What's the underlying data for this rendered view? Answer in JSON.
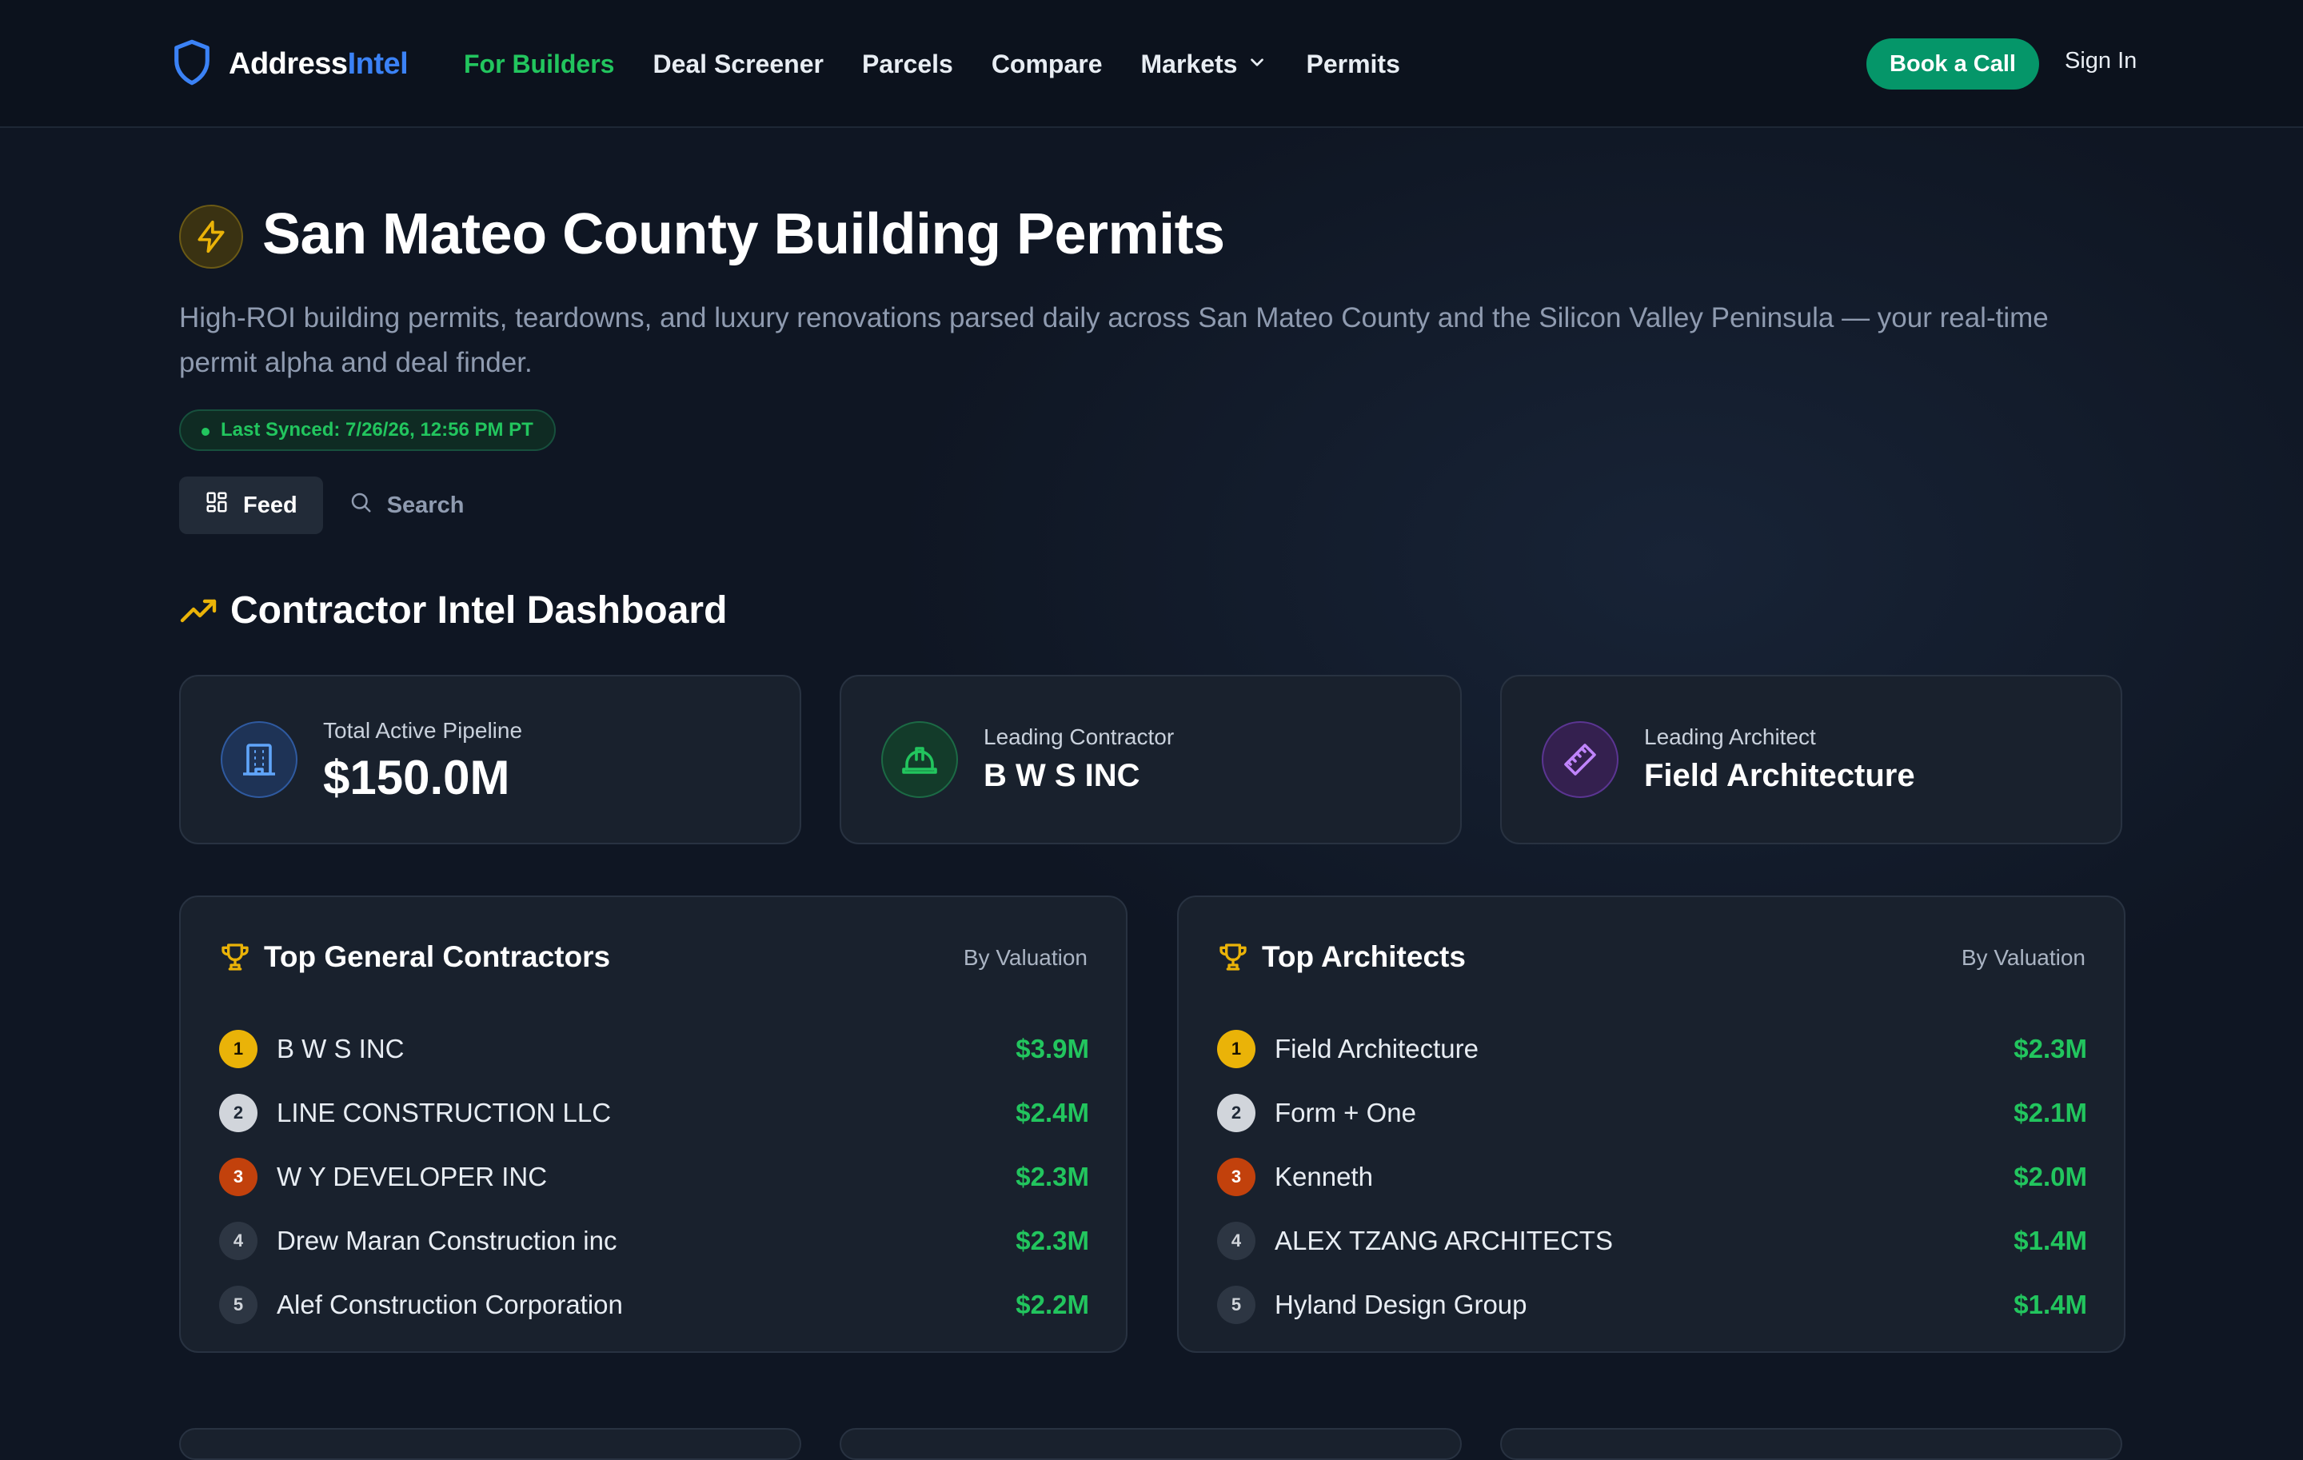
{
  "nav": {
    "brand_part1": "Address",
    "brand_part2": "Intel",
    "links": [
      {
        "label": "For Builders",
        "active": true
      },
      {
        "label": "Deal Screener"
      },
      {
        "label": "Parcels"
      },
      {
        "label": "Compare"
      },
      {
        "label": "Markets",
        "dropdown": true
      },
      {
        "label": "Permits"
      }
    ],
    "cta": "Book a Call",
    "signin": "Sign In"
  },
  "header": {
    "title": "San Mateo County Building Permits",
    "subtitle": "High-ROI building permits, teardowns, and luxury renovations parsed daily across San Mateo County and the Silicon Valley Peninsula — your real-time permit alpha and deal finder.",
    "sync": "Last Synced: 7/26/26, 12:56 PM PT",
    "tabs": [
      {
        "label": "Feed",
        "icon": "grid-icon",
        "active": true
      },
      {
        "label": "Search",
        "icon": "search-icon"
      }
    ]
  },
  "dashboard": {
    "title": "Contractor Intel Dashboard",
    "stats": [
      {
        "label": "Total Active Pipeline",
        "value": "$150.0M",
        "icon": "building-icon",
        "color": "#3b82f6"
      },
      {
        "label": "Leading Contractor",
        "value": "B W S INC",
        "icon": "hard-hat-icon",
        "color": "#22c55e"
      },
      {
        "label": "Leading Architect",
        "value": "Field Architecture",
        "icon": "ruler-icon",
        "color": "#a855f7"
      }
    ],
    "contractors": {
      "title": "Top General Contractors",
      "subtitle": "By Valuation",
      "rows": [
        {
          "rank": "1",
          "name": "B W S INC",
          "value": "$3.9M"
        },
        {
          "rank": "2",
          "name": "LINE CONSTRUCTION LLC",
          "value": "$2.4M"
        },
        {
          "rank": "3",
          "name": "W Y DEVELOPER INC",
          "value": "$2.3M"
        },
        {
          "rank": "4",
          "name": "Drew Maran Construction inc",
          "value": "$2.3M"
        },
        {
          "rank": "5",
          "name": "Alef Construction Corporation",
          "value": "$2.2M"
        }
      ]
    },
    "architects": {
      "title": "Top Architects",
      "subtitle": "By Valuation",
      "rows": [
        {
          "rank": "1",
          "name": "Field Architecture",
          "value": "$2.3M"
        },
        {
          "rank": "2",
          "name": "Form + One",
          "value": "$2.1M"
        },
        {
          "rank": "3",
          "name": "Kenneth",
          "value": "$2.0M"
        },
        {
          "rank": "4",
          "name": "ALEX TZANG ARCHITECTS",
          "value": "$1.4M"
        },
        {
          "rank": "5",
          "name": "Hyland Design Group",
          "value": "$1.4M"
        }
      ]
    }
  }
}
